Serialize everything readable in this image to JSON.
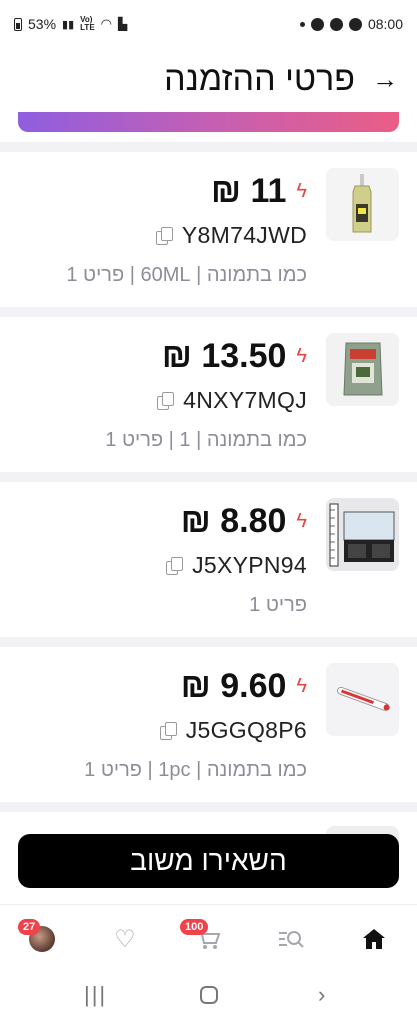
{
  "status_bar": {
    "battery": "53%",
    "network_label_top": "Vo)",
    "network_label_bottom": "LTE",
    "time": "08:00"
  },
  "header": {
    "title": "פרטי ההזמנה",
    "back_glyph": "→"
  },
  "items": [
    {
      "price": "11 ₪",
      "sku": "Y8M74JWD",
      "variant": "כמו בתמונה | 60ML | פריט 1",
      "thumb_icon": "glue-bottle-image"
    },
    {
      "price": "13.50 ₪",
      "sku": "4NXY7MQJ",
      "variant": "כמו בתמונה | 1 | פריט 1",
      "thumb_icon": "pouch-image"
    },
    {
      "price": "8.80 ₪",
      "sku": "J5XYPN94",
      "variant": "פריט 1",
      "thumb_icon": "aquarium-image"
    },
    {
      "price": "9.60 ₪",
      "sku": "J5GGQ8P6",
      "variant": "כמו בתמונה | 1pc | פריט 1",
      "thumb_icon": "thermometer-image"
    }
  ],
  "cta": {
    "label": "השאירו משוב"
  },
  "bottom_nav": {
    "profile_badge": "27",
    "cart_badge": "100"
  },
  "colors": {
    "accent_bolt": "#e84545",
    "gradient_start": "#8f5ee0",
    "gradient_end": "#ea5e86",
    "badge": "#f0424a"
  }
}
